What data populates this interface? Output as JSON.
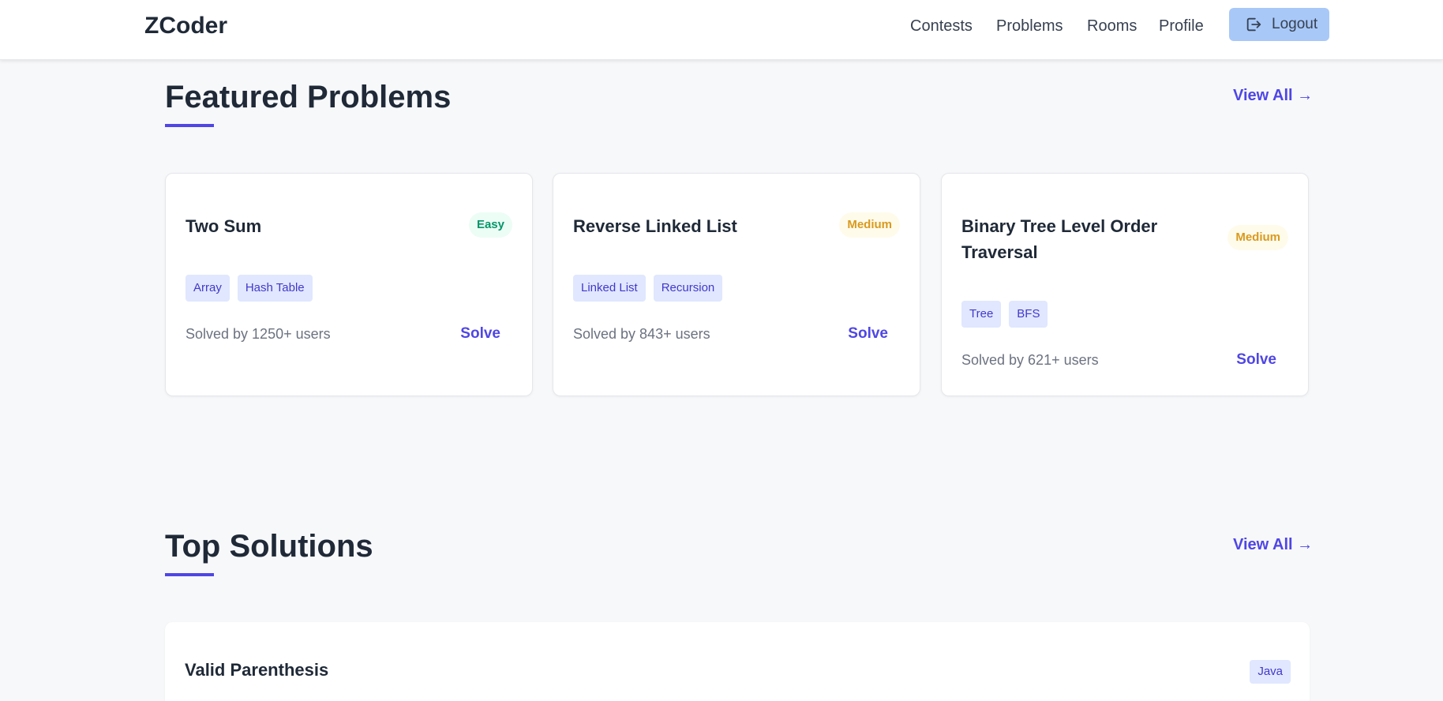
{
  "nav": {
    "brand": "ZCoder",
    "links": [
      "Contests",
      "Problems",
      "Rooms",
      "Profile"
    ],
    "logout_label": "Logout",
    "logout_icon": "logout-icon"
  },
  "featured": {
    "title": "Featured Problems",
    "view_all": "View All →",
    "problems": [
      {
        "title": "Two Sum",
        "difficulty": "Easy",
        "tags": [
          "Array",
          "Hash Table"
        ],
        "solved": "Solved by 1250+ users",
        "action": "Solve"
      },
      {
        "title": "Reverse Linked List",
        "difficulty": "Medium",
        "tags": [
          "Linked List",
          "Recursion"
        ],
        "solved": "Solved by 843+ users",
        "action": "Solve"
      },
      {
        "title_line1": "Binary Tree Level Order",
        "title_line2": "Traversal",
        "difficulty": "Medium",
        "tags": [
          "Tree",
          "BFS"
        ],
        "solved": "Solved by 621+ users",
        "action": "Solve"
      }
    ]
  },
  "solutions": {
    "title": "Top Solutions",
    "view_all": "View All →",
    "items": [
      {
        "title": "Valid Parenthesis",
        "language": "Java"
      }
    ]
  },
  "colors": {
    "accent": "#4f46e5",
    "easy": "#059669",
    "medium": "#d99a1e",
    "logout_bg": "#a8c8f8"
  }
}
